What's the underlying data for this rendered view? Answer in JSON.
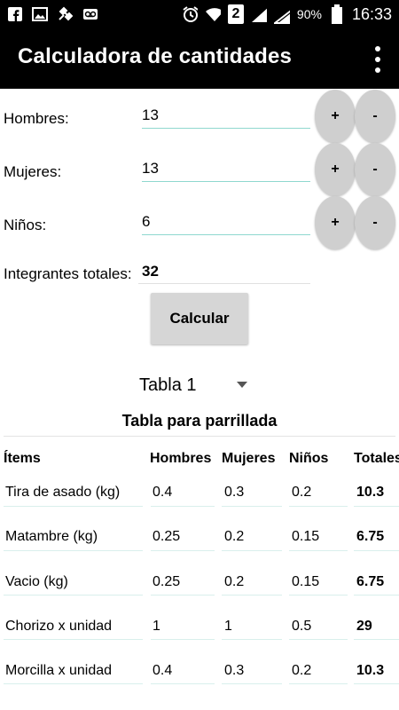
{
  "status_bar": {
    "battery": "90%",
    "time": "16:33",
    "sim_slot": "2",
    "icons_left": [
      "facebook-icon",
      "image-icon",
      "satellite-icon",
      "voicemail-icon"
    ],
    "icons_right": [
      "alarm-icon",
      "wifi-icon",
      "sim-icon",
      "signal-icon",
      "signal-icon",
      "battery-icon"
    ]
  },
  "app_bar": {
    "title": "Calculadora de cantidades",
    "menu_icon": "more-vert-icon"
  },
  "form": {
    "rows": [
      {
        "label": "Hombres:",
        "value": "13",
        "plus": "+",
        "minus": "-"
      },
      {
        "label": "Mujeres:",
        "value": "13",
        "plus": "+",
        "minus": "-"
      },
      {
        "label": "Niños:",
        "value": "6",
        "plus": "+",
        "minus": "-"
      }
    ],
    "total_label": "Integrantes totales:",
    "total_value": "32",
    "calculate_label": "Calcular"
  },
  "spinner": {
    "selected": "Tabla 1"
  },
  "table": {
    "title": "Tabla para parrillada",
    "headers": [
      "Ítems",
      "Hombres",
      "Mujeres",
      "Niños",
      "Totales"
    ],
    "rows": [
      [
        "Tira de asado (kg)",
        "0.4",
        "0.3",
        "0.2",
        "10.3"
      ],
      [
        "Matambre (kg)",
        "0.25",
        "0.2",
        "0.15",
        "6.75"
      ],
      [
        "Vacio (kg)",
        "0.25",
        "0.2",
        "0.15",
        "6.75"
      ],
      [
        "Chorizo x unidad",
        "1",
        "1",
        "0.5",
        "29"
      ],
      [
        "Morcilla x unidad",
        "0.4",
        "0.3",
        "0.2",
        "10.3"
      ]
    ]
  },
  "colors": {
    "bar": "#000000",
    "accent_underline": "#8fd8cf",
    "button": "#cfcfcf"
  }
}
